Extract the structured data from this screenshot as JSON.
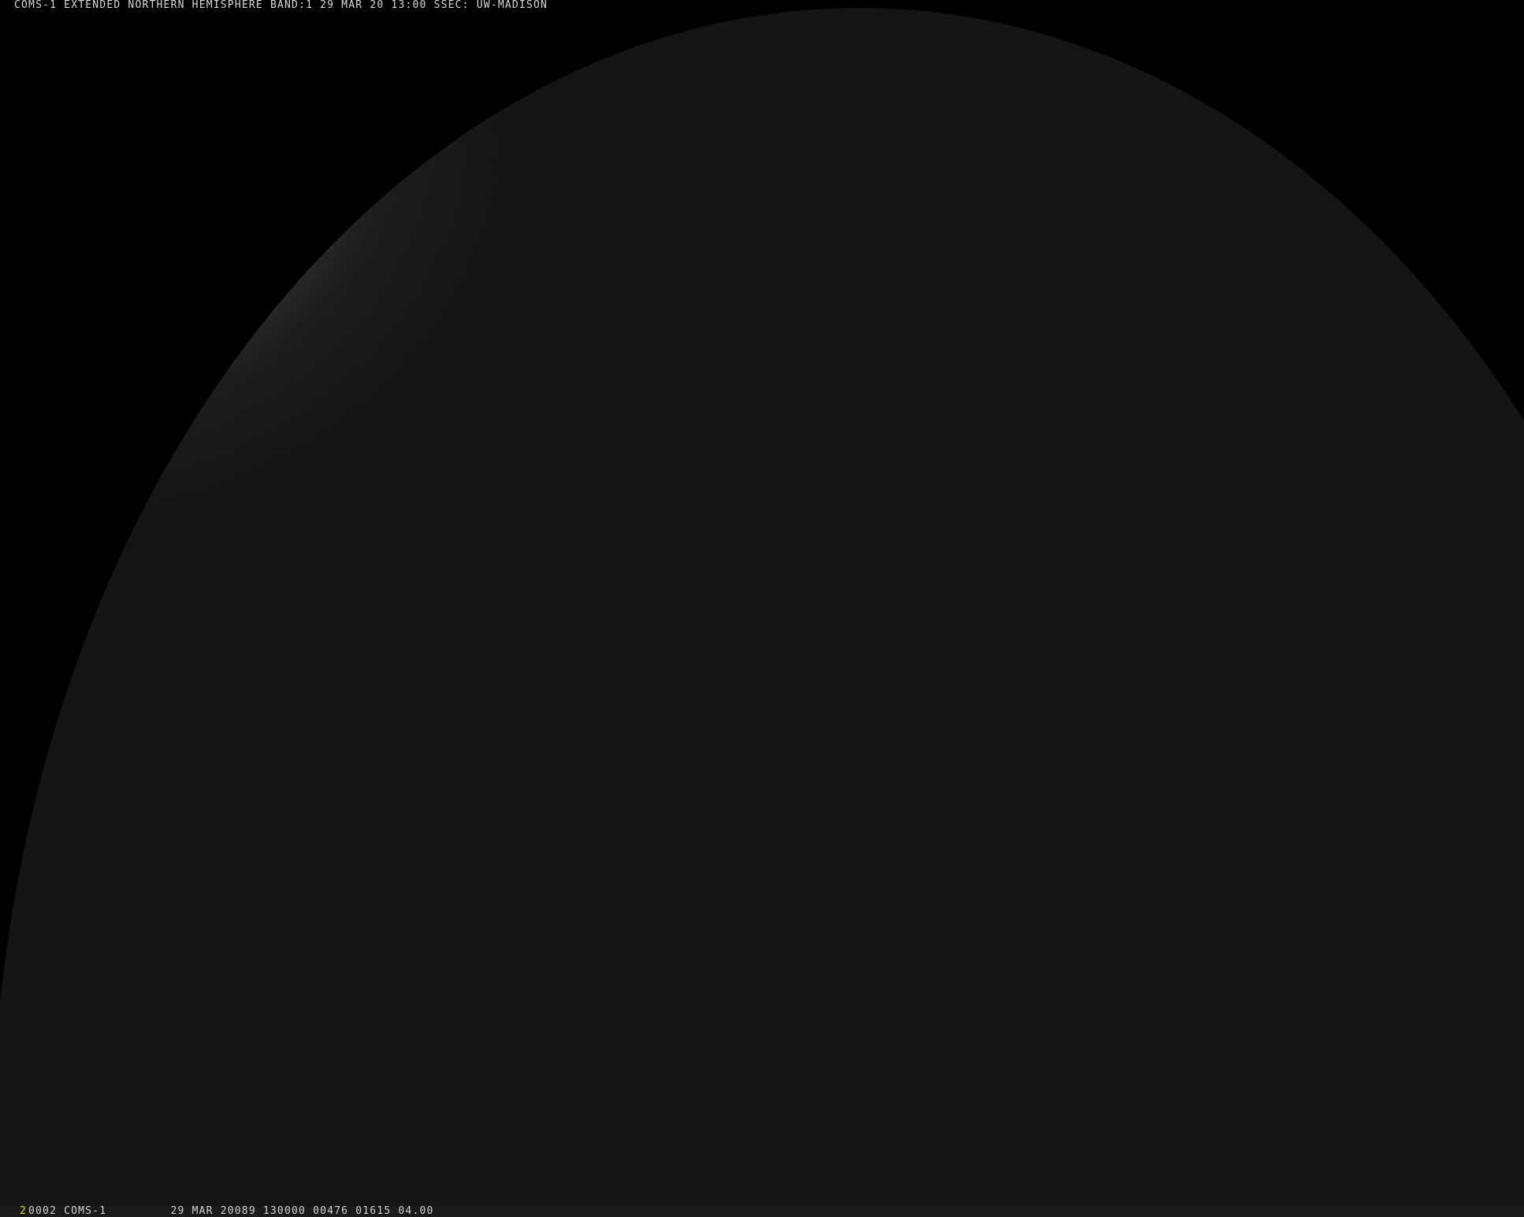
{
  "header": {
    "title": "COMS-1 EXTENDED NORTHERN HEMISPHERE BAND:1 29 MAR 20 13:00 SSEC: UW-MADISON"
  },
  "footer": {
    "frame_index": "2",
    "frame_index_color": "#e6d200",
    "info": "0002 COMS-1         29 MAR 20089 130000 00476 01615 04.00"
  },
  "colors": {
    "space": "#000000",
    "night_side": "#0e0e0e",
    "day_side_highlight": "#8a8a8a",
    "coastline": "#000000"
  }
}
